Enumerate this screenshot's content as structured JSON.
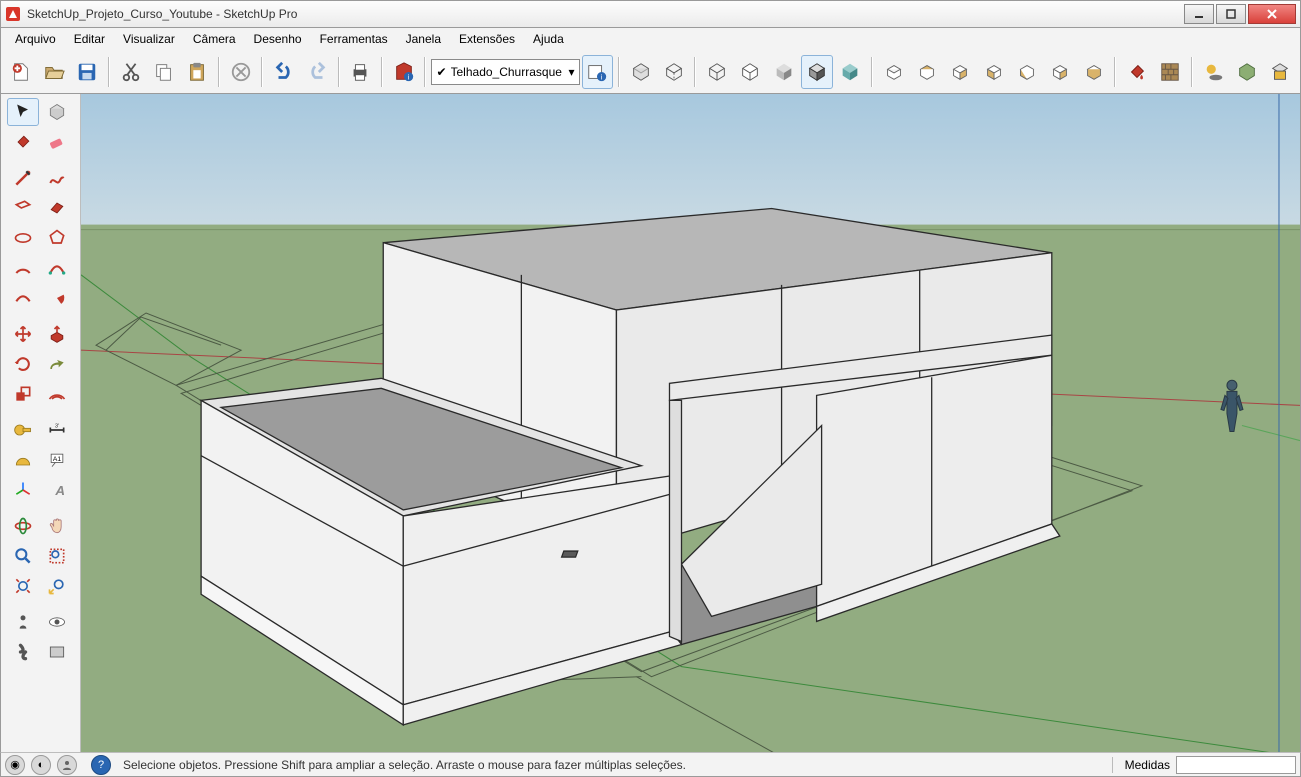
{
  "titlebar": {
    "filename": "SketchUp_Projeto_Curso_Youtube",
    "appname": "SketchUp Pro"
  },
  "menu": [
    "Arquivo",
    "Editar",
    "Visualizar",
    "Câmera",
    "Desenho",
    "Ferramentas",
    "Janela",
    "Extensões",
    "Ajuda"
  ],
  "layerCombo": {
    "value": "Telhado_Churrasque"
  },
  "status": {
    "text": "Selecione objetos. Pressione Shift para ampliar a seleção. Arraste o mouse para fazer múltiplas seleções.",
    "measureLabel": "Medidas"
  }
}
